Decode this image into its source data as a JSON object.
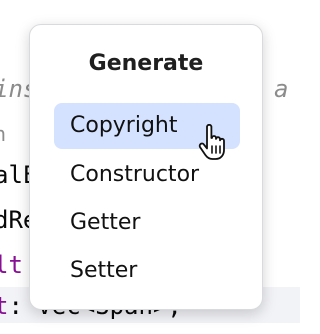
{
  "editor": {
    "lines": [
      {
        "text": "ins"
      },
      {
        "text": "n"
      },
      {
        "text": "alE"
      },
      {
        "text": "dRe"
      },
      {
        "text": "lt"
      },
      {
        "text": "t: Vec<Span>,"
      }
    ],
    "right_fragment": "a"
  },
  "popup": {
    "title": "Generate",
    "items": [
      {
        "label": "Copyright",
        "selected": true
      },
      {
        "label": "Constructor",
        "selected": false
      },
      {
        "label": "Getter",
        "selected": false
      },
      {
        "label": "Setter",
        "selected": false
      }
    ]
  },
  "colors": {
    "selection": "#d4e2ff",
    "keyword": "#871094",
    "comment": "#8c8c8c"
  },
  "icons": {
    "cursor": "hand-pointer-icon"
  }
}
